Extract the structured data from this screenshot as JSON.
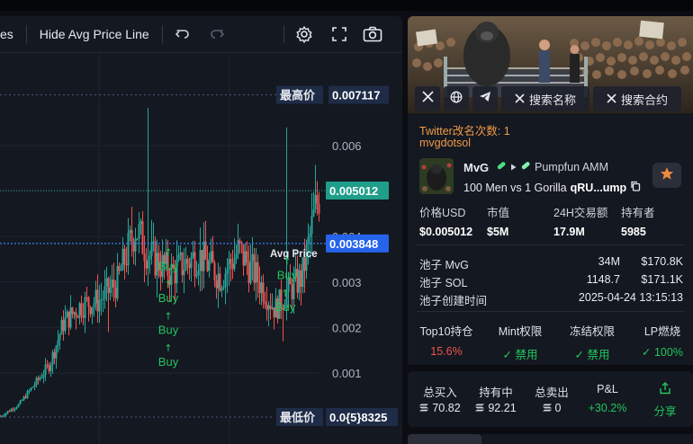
{
  "toolbar": {
    "partial_label": "es",
    "hide_avg_label": "Hide Avg Price Line",
    "icons": [
      "undo-icon",
      "redo-icon",
      "settings-icon",
      "fullscreen-icon",
      "camera-icon"
    ]
  },
  "chart": {
    "high_label": "最高价",
    "high_value": "0.007117",
    "current_value": "0.005012",
    "avg_value": "0.003848",
    "avg_tag": "Avg Price",
    "low_label": "最低价",
    "low_value": "0.0{5}8325",
    "buy_text": "Buy",
    "colors": {
      "up": "#26a69a",
      "down": "#ef5350",
      "buy": "#22c55e",
      "avg": "#3b82f6"
    }
  },
  "chart_data": {
    "type": "candlestick",
    "y_ticks": [
      "0.006",
      "0.005",
      "0.004",
      "0.003",
      "0.002",
      "0.001"
    ],
    "ylim": [
      0.0,
      0.0072
    ],
    "high": 0.007117,
    "current": 0.005012,
    "avg": 0.003848,
    "markers": [
      {
        "label": "Buy",
        "y": 0.0033
      },
      {
        "label": "Buy",
        "y": 0.0026
      },
      {
        "label": "Buy",
        "y": 0.0019
      },
      {
        "label": "Buy",
        "y": 0.0012
      },
      {
        "label": "Buy",
        "y": 0.0031
      },
      {
        "label": "Buy",
        "y": 0.0024
      }
    ]
  },
  "banner": {
    "search_name_label": "搜索名称",
    "search_contract_label": "搜索合约",
    "icons": [
      "x-icon",
      "globe-icon",
      "telegram-icon"
    ]
  },
  "token": {
    "rename_text": "Twitter改名次数: 1",
    "handle": "mvgdotsol",
    "symbol": "MvG",
    "platform": "Pumpfun AMM",
    "name": "100 Men vs 1 Gorilla",
    "address": "qRU...ump"
  },
  "stats": [
    {
      "label": "价格USD",
      "value": "$0.005012"
    },
    {
      "label": "市值",
      "value": "$5M"
    },
    {
      "label": "24H交易额",
      "value": "17.9M"
    },
    {
      "label": "持有者",
      "value": "5985"
    }
  ],
  "pool": [
    {
      "label": "池子 MvG",
      "value1": "34M",
      "value2": "$170.8K"
    },
    {
      "label": "池子 SOL",
      "value1": "1148.7",
      "value2": "$171.1K"
    },
    {
      "label": "池子创建时间",
      "value1": "",
      "value2": "2025-04-24 13:15:13"
    }
  ],
  "risk": [
    {
      "label": "Top10持仓",
      "value": "15.6%",
      "color": "#ef5350"
    },
    {
      "label": "Mint权限",
      "value": "✓ 禁用",
      "color": "#22c55e"
    },
    {
      "label": "冻结权限",
      "value": "✓ 禁用",
      "color": "#22c55e"
    },
    {
      "label": "LP燃烧",
      "value": "✓ 100%",
      "color": "#22c55e"
    }
  ],
  "pnl": [
    {
      "label": "总买入",
      "value": "70.82"
    },
    {
      "label": "持有中",
      "value": "92.21"
    },
    {
      "label": "总卖出",
      "value": "0"
    },
    {
      "label": "P&L",
      "value": "+30.2%"
    },
    {
      "label": "",
      "value": "分享"
    }
  ]
}
